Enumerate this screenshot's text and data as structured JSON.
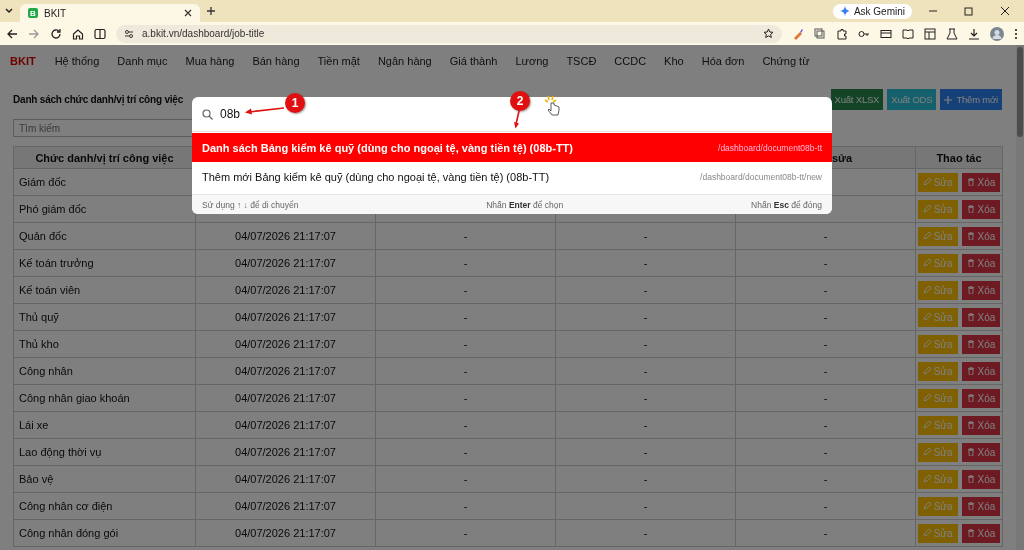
{
  "browser": {
    "tab": {
      "favicon": "B",
      "title": "BKIT"
    },
    "gemini": "Ask Gemini",
    "url": "a.bkit.vn/dashboard/job-title"
  },
  "app": {
    "logo": "BKIT",
    "menu": [
      "Hệ thống",
      "Danh mục",
      "Mua hàng",
      "Bán hàng",
      "Tiền mặt",
      "Ngân hàng",
      "Giá thành",
      "Lương",
      "TSCĐ",
      "CCDC",
      "Kho",
      "Hóa đơn",
      "Chứng từ"
    ]
  },
  "page": {
    "title": "Danh sách chức danh/vị trí công việc",
    "search": {
      "placeholder": "Tìm kiếm"
    },
    "buttons": [
      {
        "kind": "xlsx",
        "label": "Xuất XLSX"
      },
      {
        "kind": "ods",
        "label": "Xuất ODS"
      },
      {
        "kind": "add",
        "label": "Thêm mới"
      }
    ]
  },
  "table": {
    "headers": {
      "column_1": "Chức danh/vị trí công việc",
      "column_5": "sửa",
      "column_6": "Thao tác"
    },
    "rows": [
      {
        "column_1": "Giám đốc",
        "actions": [
          {
            "kind": "edit",
            "label": "Sửa"
          },
          {
            "kind": "delete",
            "label": "Xóa"
          }
        ]
      },
      {
        "column_1": "Phó giám đốc",
        "actions": [
          {
            "kind": "edit",
            "label": "Sửa"
          },
          {
            "kind": "delete",
            "label": "Xóa"
          }
        ]
      },
      {
        "column_1": "Quản đốc",
        "column_2": "04/07/2026 21:17:07",
        "column_3": "-",
        "column_4": "-",
        "column_5": "-",
        "actions": [
          {
            "kind": "edit",
            "label": "Sửa"
          },
          {
            "kind": "delete",
            "label": "Xóa"
          }
        ]
      },
      {
        "column_1": "Kế toán trưởng",
        "column_2": "04/07/2026 21:17:07",
        "column_3": "-",
        "column_4": "-",
        "column_5": "-",
        "actions": [
          {
            "kind": "edit",
            "label": "Sửa"
          },
          {
            "kind": "delete",
            "label": "Xóa"
          }
        ]
      },
      {
        "column_1": "Kế toán viên",
        "column_2": "04/07/2026 21:17:07",
        "column_3": "-",
        "column_4": "-",
        "column_5": "-",
        "actions": [
          {
            "kind": "edit",
            "label": "Sửa"
          },
          {
            "kind": "delete",
            "label": "Xóa"
          }
        ]
      },
      {
        "column_1": "Thủ quỹ",
        "column_2": "04/07/2026 21:17:07",
        "column_3": "-",
        "column_4": "-",
        "column_5": "-",
        "actions": [
          {
            "kind": "edit",
            "label": "Sửa"
          },
          {
            "kind": "delete",
            "label": "Xóa"
          }
        ]
      },
      {
        "column_1": "Thủ kho",
        "column_2": "04/07/2026 21:17:07",
        "column_3": "-",
        "column_4": "-",
        "column_5": "-",
        "actions": [
          {
            "kind": "edit",
            "label": "Sửa"
          },
          {
            "kind": "delete",
            "label": "Xóa"
          }
        ]
      },
      {
        "column_1": "Công nhân",
        "column_2": "04/07/2026 21:17:07",
        "column_3": "-",
        "column_4": "-",
        "column_5": "-",
        "actions": [
          {
            "kind": "edit",
            "label": "Sửa"
          },
          {
            "kind": "delete",
            "label": "Xóa"
          }
        ]
      },
      {
        "column_1": "Công nhân giao khoán",
        "column_2": "04/07/2026 21:17:07",
        "column_3": "-",
        "column_4": "-",
        "column_5": "-",
        "actions": [
          {
            "kind": "edit",
            "label": "Sửa"
          },
          {
            "kind": "delete",
            "label": "Xóa"
          }
        ]
      },
      {
        "column_1": "Lái xe",
        "column_2": "04/07/2026 21:17:07",
        "column_3": "-",
        "column_4": "-",
        "column_5": "-",
        "actions": [
          {
            "kind": "edit",
            "label": "Sửa"
          },
          {
            "kind": "delete",
            "label": "Xóa"
          }
        ]
      },
      {
        "column_1": "Lao động thời vụ",
        "column_2": "04/07/2026 21:17:07",
        "column_3": "-",
        "column_4": "-",
        "column_5": "-",
        "actions": [
          {
            "kind": "edit",
            "label": "Sửa"
          },
          {
            "kind": "delete",
            "label": "Xóa"
          }
        ]
      },
      {
        "column_1": "Bảo vệ",
        "column_2": "04/07/2026 21:17:07",
        "column_3": "-",
        "column_4": "-",
        "column_5": "-",
        "actions": [
          {
            "kind": "edit",
            "label": "Sửa"
          },
          {
            "kind": "delete",
            "label": "Xóa"
          }
        ]
      },
      {
        "column_1": "Công nhân cơ điện",
        "column_2": "04/07/2026 21:17:07",
        "column_3": "-",
        "column_4": "-",
        "column_5": "-",
        "actions": [
          {
            "kind": "edit",
            "label": "Sửa"
          },
          {
            "kind": "delete",
            "label": "Xóa"
          }
        ]
      },
      {
        "column_1": "Công nhân đóng gói",
        "column_2": "04/07/2026 21:17:07",
        "column_3": "-",
        "column_4": "-",
        "column_5": "-",
        "actions": [
          {
            "kind": "edit",
            "label": "Sửa"
          },
          {
            "kind": "delete",
            "label": "Xóa"
          }
        ]
      }
    ]
  },
  "search_modal": {
    "query": "08b",
    "results": [
      {
        "title": "Danh sách Bảng kiểm kê quỹ (dùng cho ngoại tệ, vàng tiền tệ) (08b-TT)",
        "path": "/dashboard/document08b-tt",
        "selected": true
      },
      {
        "title": "Thêm mới Bảng kiểm kê quỹ (dùng cho ngoại tệ, vàng tiền tệ) (08b-TT)",
        "path": "/dashboard/document08b-tt/new",
        "selected": false
      }
    ],
    "hints": [
      "Sử dụng ↑ ↓ để di chuyển",
      "Nhấn **Enter** để chọn",
      "Nhấn **Esc** để đóng"
    ]
  },
  "callouts": [
    {
      "label": "1"
    },
    {
      "label": "2"
    }
  ]
}
